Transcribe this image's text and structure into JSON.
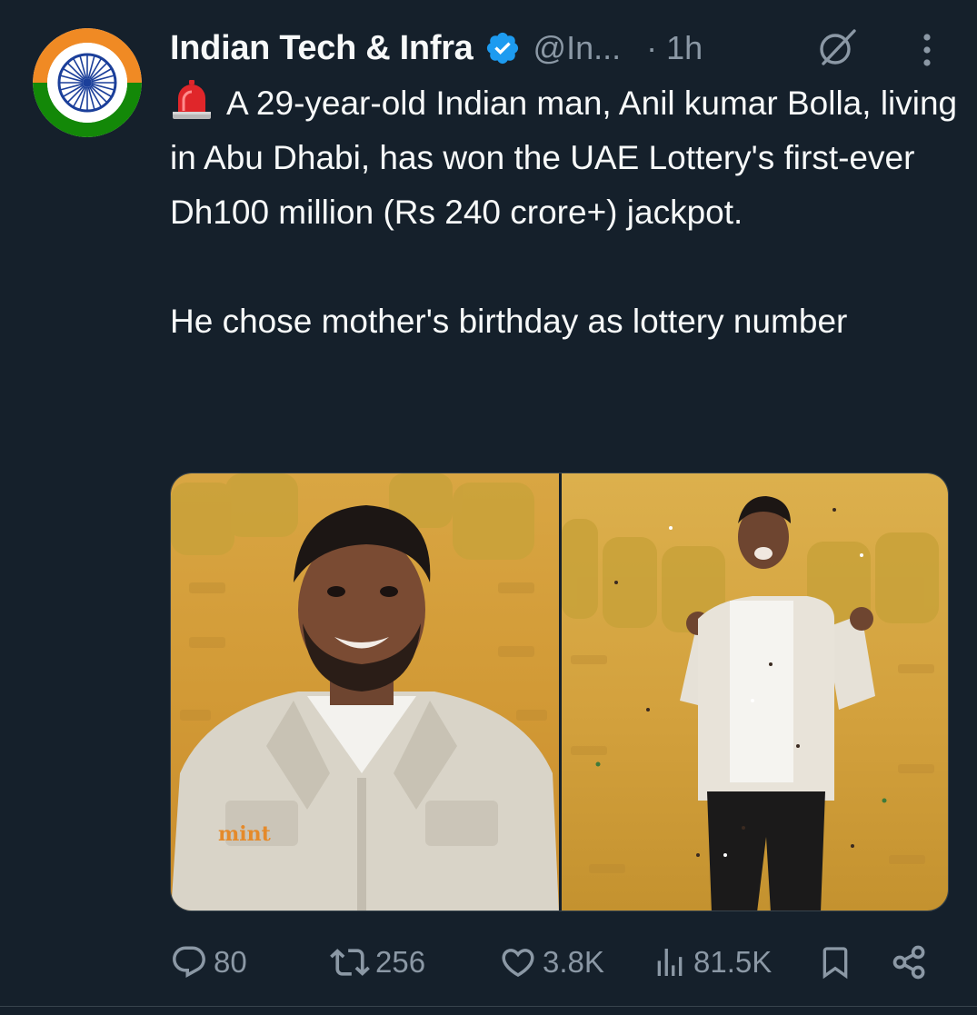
{
  "author": {
    "display_name": "Indian Tech & Infra",
    "handle": "@In...",
    "verified": true,
    "timestamp": "· 1h",
    "avatar_icon": "indian-flag-ashoka-chakra-icon"
  },
  "tweet": {
    "line1": "A 29-year-old Indian man, Anil kumar Bolla, living in Abu Dhabi, has won the UAE Lottery's first-ever Dh100 million (Rs 240 crore+) jackpot.",
    "line2": "He chose mother's birthday as lottery number",
    "emoji": "police-siren"
  },
  "media": {
    "count": 2,
    "watermark": "mint"
  },
  "actions": {
    "replies": "80",
    "reposts": "256",
    "likes": "3.8K",
    "views": "81.5K"
  },
  "colors": {
    "background": "#15202b",
    "text": "#f7f9f9",
    "muted": "#8b98a5",
    "verified": "#1d9bf0"
  }
}
